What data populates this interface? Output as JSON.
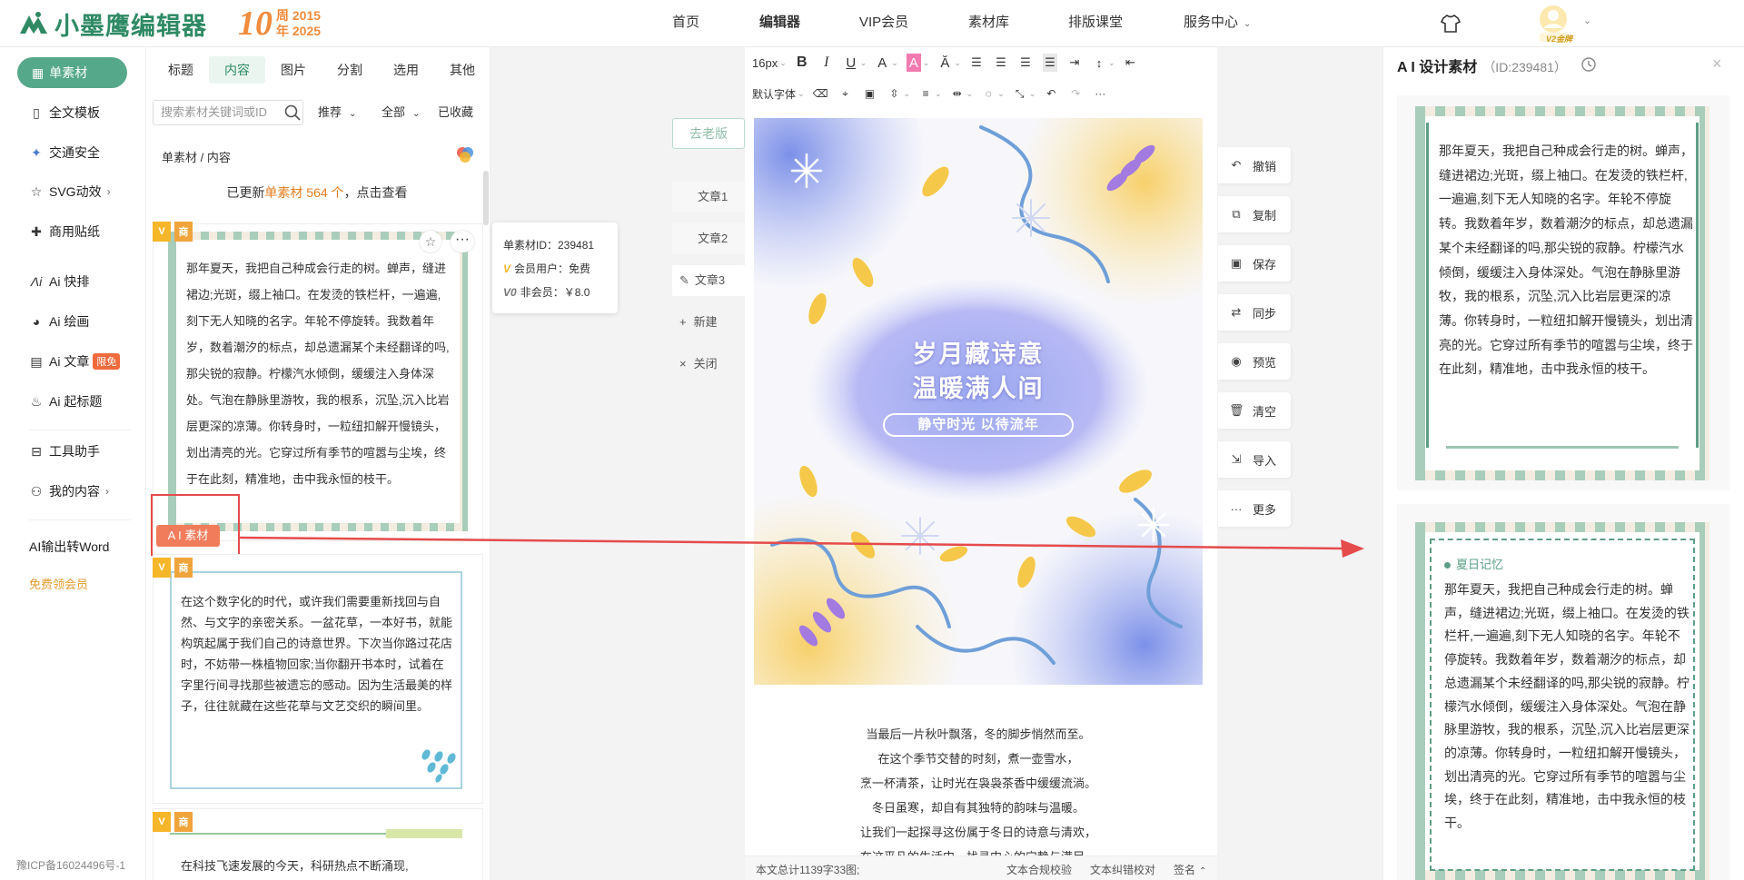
{
  "header": {
    "brand": "小墨鹰编辑器",
    "anniversary_number": "10",
    "anniversary_top": "周 2015",
    "anniversary_bottom": "年 2025",
    "nav": [
      "首页",
      "编辑器",
      "VIP会员",
      "素材库",
      "排版课堂",
      "服务中心"
    ],
    "active_nav": "编辑器",
    "avatar_badge": "V2金牌"
  },
  "sidebar": {
    "active": "单素材",
    "items": [
      "全文模板",
      "交通安全",
      "SVG动效",
      "商用贴纸",
      "Ai 快排",
      "Ai 绘画",
      "Ai 文章",
      "Ai 起标题",
      "工具助手",
      "我的内容"
    ],
    "hot_badge": "限免",
    "ai_word": "AI输出转Word",
    "free_member": "免费领会员",
    "icp": "豫ICP备16024496号-1"
  },
  "material": {
    "tabs": [
      "标题",
      "内容",
      "图片",
      "分割",
      "选用",
      "其他"
    ],
    "active_tab": "内容",
    "search_placeholder": "搜索素材关键词或ID",
    "filters": [
      "推荐",
      "全部",
      "已收藏"
    ],
    "breadcrumb": "单素材 / 内容",
    "updated_prefix": "已更新",
    "updated_highlight": "单素材 564 个",
    "updated_suffix": "，点击查看",
    "badge_v": "V",
    "badge_shang": "商",
    "ai_tag": "A I 素材",
    "card1_text": "那年夏天，我把自己种成会行走的树。蝉声，缝进裙边;光斑，缀上袖口。在发烫的铁栏杆，一遍遍,刻下无人知晓的名字。年轮不停旋转。我数着年岁，数着潮汐的标点，却总遗漏某个未经翻译的吗,那尖锐的寂静。柠檬汽水倾倒，缓缓注入身体深处。气泡在静脉里游牧，我的根系，沉坠,沉入比岩层更深的凉薄。你转身时，一粒纽扣解开慢镜头，划出清亮的光。它穿过所有季节的喧嚣与尘埃，终于在此刻，精准地，击中我永恒的枝干。",
    "card2_text": "在这个数字化的时代，或许我们需要重新找回与自然、与文字的亲密关系。一盆花草，一本好书，就能构筑起属于我们自己的诗意世界。下次当你路过花店时，不妨带一株植物回家;当你翻开书本时，试着在字里行间寻找那些被遗忘的感动。因为生活最美的样子，往往就藏在这些花草与文艺交织的瞬间里。",
    "card3_text": "在科技飞速发展的今天，科研热点不断涌现,"
  },
  "tooltip": {
    "id_line": "单素材ID：239481",
    "member_line": "会员用户：免费",
    "nonmember_line": "非会员：￥8.0",
    "vip_glyph": "V",
    "nonvip_glyph": "V0"
  },
  "articles": {
    "old_version": "去老版",
    "items": [
      "文章1",
      "文章2",
      "文章3"
    ],
    "active": "文章3",
    "new": "新建",
    "close": "关闭"
  },
  "editor": {
    "font_size": "16px",
    "font_family": "默认字体",
    "cover_title_line1": "岁月藏诗意",
    "cover_title_line2": "温暖满人间",
    "cover_subtitle": "静守时光 以待流年",
    "poem_lines": [
      "当最后一片秋叶飘落，冬的脚步悄然而至。",
      "在这个季节交替的时刻，煮一壶雪水，",
      "烹一杯清茶，让时光在袅袅茶香中缓缓流淌。",
      "冬日虽寒，却自有其独特的韵味与温暖。",
      "让我们一起探寻这份属于冬日的诗意与清欢，",
      "在这平凡的生活中，找寻内心的宁静与满足。"
    ],
    "status_count": "本文总计1139字33图;",
    "status_check": "文本合规校验",
    "status_typo": "文本纠错校对",
    "status_sign": "签名"
  },
  "float_menu": [
    "撤销",
    "复制",
    "保存",
    "同步",
    "预览",
    "清空",
    "导入",
    "更多"
  ],
  "right_panel": {
    "title": "A I 设计素材",
    "id_label": "（ID:239481）",
    "card_text": "那年夏天，我把自己种成会行走的树。蝉声，缝进裙边;光斑，缀上袖口。在发烫的铁栏杆,一遍遍,刻下无人知晓的名字。年轮不停旋转。我数着年岁，数着潮汐的标点，却总遗漏某个未经翻译的吗,那尖锐的寂静。柠檬汽水倾倒，缓缓注入身体深处。气泡在静脉里游牧，我的根系，沉坠,沉入比岩层更深的凉薄。你转身时，一粒纽扣解开慢镜头，划出清亮的光。它穿过所有季节的喧嚣与尘埃，终于在此刻，精准地，击中我永恒的枝干。",
    "card2_label": "夏日记忆"
  },
  "colors": {
    "brand": "#2f8a64",
    "accent": "#56a88a",
    "hot": "#f06a3c",
    "arrow": "#e54b4b"
  }
}
